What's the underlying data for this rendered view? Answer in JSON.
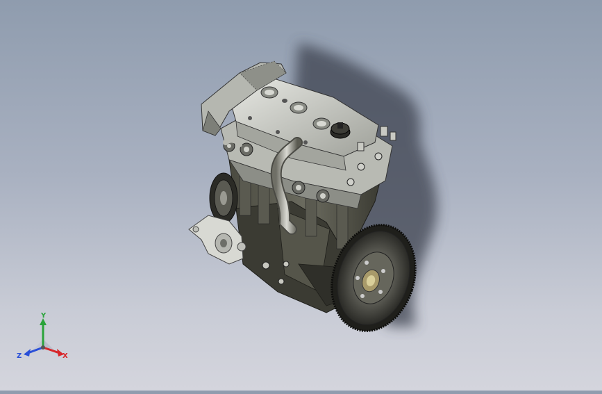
{
  "viewport": {
    "background_top": "#8f9cae",
    "background_bottom": "#d4d5dd",
    "model": "engine-assembly"
  },
  "triad": {
    "x_label": "X",
    "y_label": "Y",
    "z_label": "Z",
    "x_color": "#d8262a",
    "y_color": "#2aa33a",
    "z_color": "#2a4fd8"
  }
}
